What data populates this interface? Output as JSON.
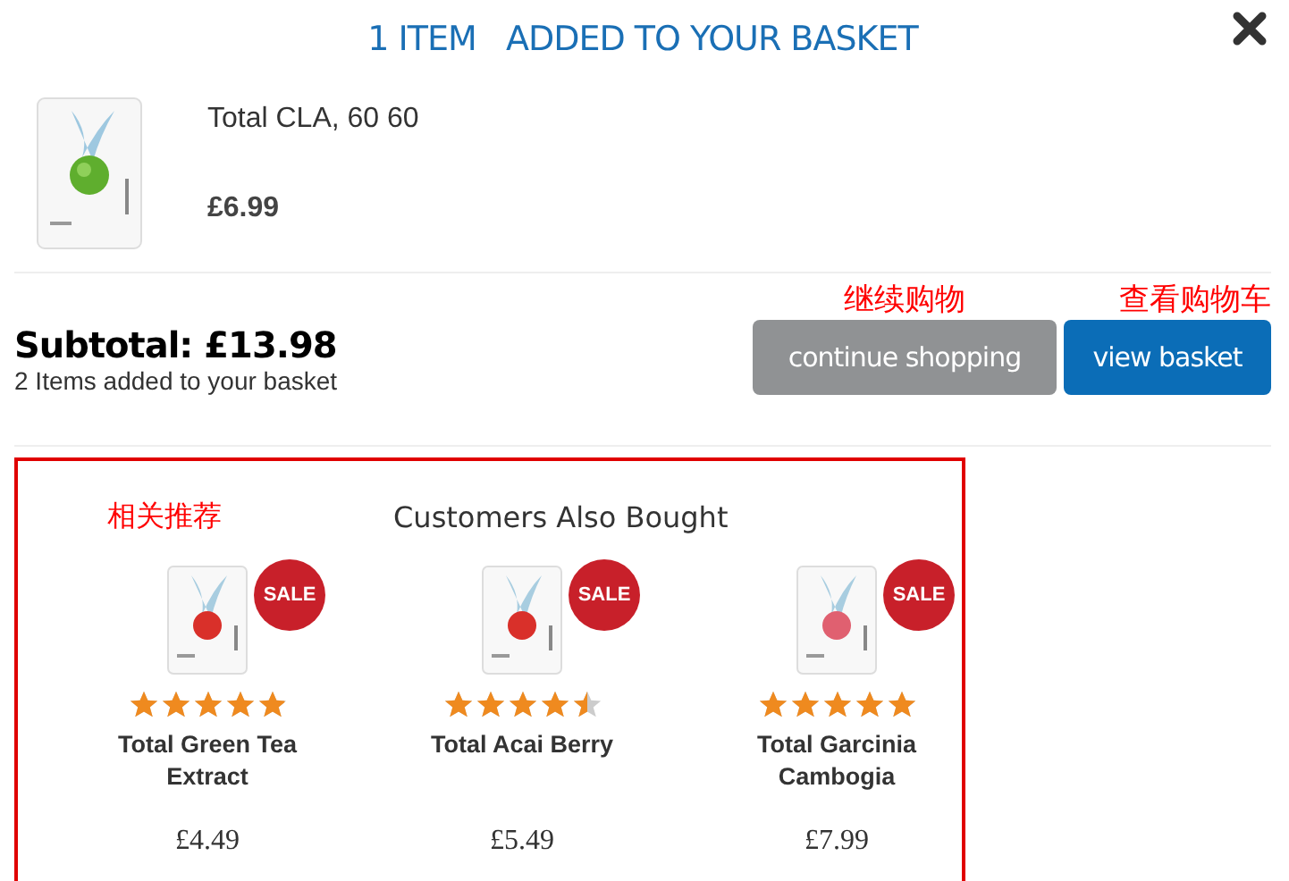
{
  "header": {
    "title": "1 ITEM   ADDED TO YOUR BASKET"
  },
  "added_item": {
    "name": "Total CLA, 60 60",
    "price": "£6.99"
  },
  "summary": {
    "subtotal": "Subtotal: £13.98",
    "items_note": "2 Items  added to your basket"
  },
  "buttons": [
    {
      "label": "continue shopping",
      "kind": "secondary",
      "annotation": "继续购物"
    },
    {
      "label": "view basket",
      "kind": "primary",
      "annotation": "查看购物车"
    }
  ],
  "recommendations": {
    "annotation": "相关推荐",
    "title": "Customers Also Bought",
    "products": [
      {
        "name": "Total Green Tea Extract",
        "price": "£4.49",
        "badge": "SALE",
        "stars": 4.9
      },
      {
        "name": "Total Acai Berry",
        "price": "£5.49",
        "badge": "SALE",
        "stars": 4.5
      },
      {
        "name": "Total Garcinia Cambogia",
        "price": "£7.99",
        "badge": "SALE",
        "stars": 5
      }
    ]
  }
}
